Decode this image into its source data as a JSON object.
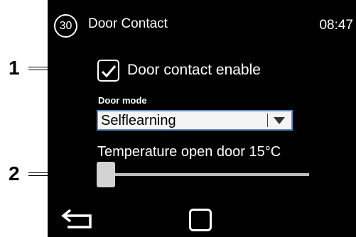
{
  "callouts": [
    "1",
    "2"
  ],
  "header": {
    "screen_number": "30",
    "title": "Door Contact",
    "time": "08:47"
  },
  "door_contact": {
    "label": "Door contact enable",
    "checked": true
  },
  "door_mode": {
    "label": "Door mode",
    "value": "Selflearning"
  },
  "temperature": {
    "label": "Temperature open door 15°C",
    "slider_level": 0
  },
  "nav": {
    "back_icon": "back-arrow-icon",
    "home_icon": "home-square-icon"
  },
  "colors": {
    "screen_background": "#000000",
    "text": "#ffffff",
    "select_border": "#5a8fc3",
    "slider_thumb": "#d3d3d3"
  }
}
